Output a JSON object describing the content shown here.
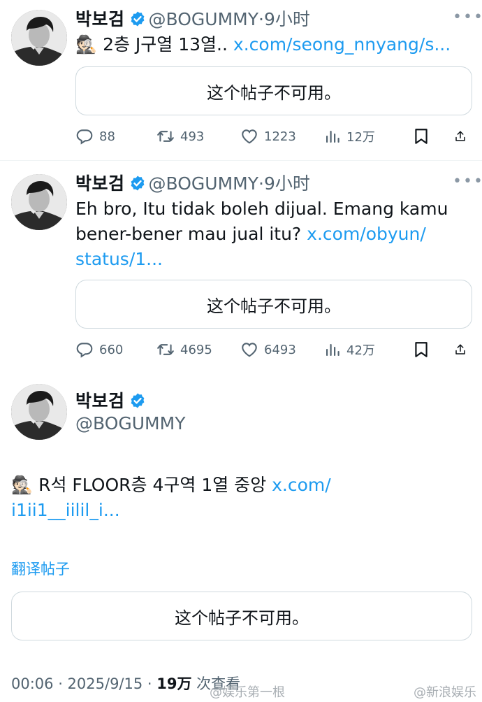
{
  "tweets": [
    {
      "name": "박보검",
      "handle": "@BOGUMMY",
      "time": "·9小时",
      "text": "🕵🏻 2층 J구열 13열.. ",
      "link": "x.com/seong_nnyang/s...",
      "card": "这个帖子不可用。",
      "replies": "88",
      "retweets": "493",
      "likes": "1223",
      "views": "12万"
    },
    {
      "name": "박보검",
      "handle": "@BOGUMMY",
      "time": "·9小时",
      "text_line1": "Eh bro, Itu tidak boleh dijual. Emang kamu",
      "text_line2": "bener-bener mau jual itu? ",
      "link_part1": "x.com/obyun/",
      "link_part2": "status/1...",
      "card": "这个帖子不可用。",
      "replies": "660",
      "retweets": "4695",
      "likes": "6493",
      "views": "42万"
    }
  ],
  "main": {
    "name": "박보검",
    "handle": "@BOGUMMY",
    "text": "🕵🏻 R석 FLOOR층 4구역 1열 중앙 ",
    "link_part1": "x.com/",
    "link_part2": "i1ii1__iilil_i...",
    "translate": "翻译帖子",
    "card": "这个帖子不可用。",
    "time": "00:06 · 2025/9/15 · ",
    "views_count": "19万",
    "views_label": " 次查看"
  },
  "watermarks": [
    "@娱乐第一根",
    "@新浪娱乐"
  ],
  "icons": [
    "reply-icon",
    "retweet-icon",
    "like-icon",
    "views-icon",
    "bookmark-icon",
    "share-icon",
    "verified-icon",
    "more-icon"
  ],
  "colors": {
    "link": "#1d9bf0",
    "muted": "#536471",
    "verified": "#1d9bf0",
    "border": "#cfd9de"
  }
}
